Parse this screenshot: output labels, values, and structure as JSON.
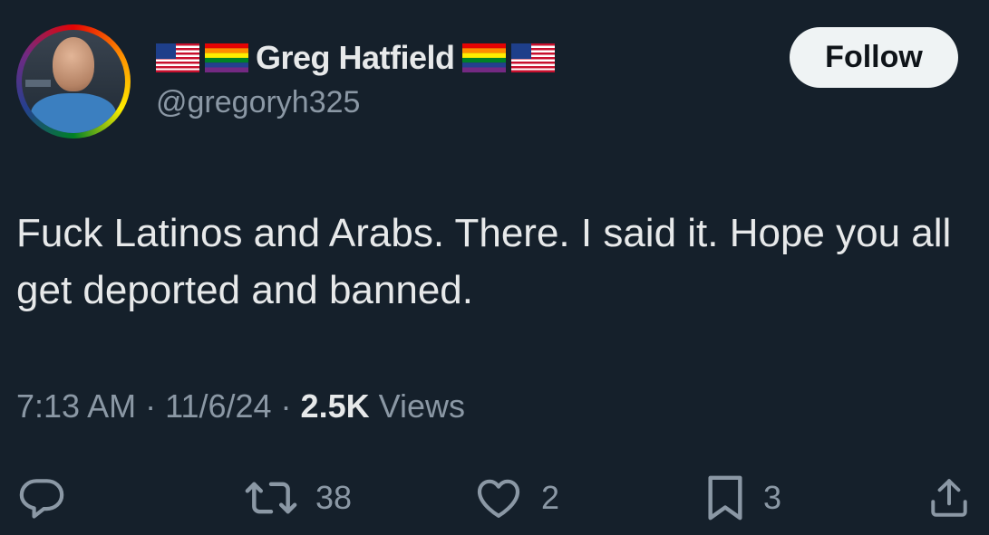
{
  "user": {
    "display_name": "Greg Hatfield",
    "handle": "@gregoryh325",
    "flags": [
      "us-flag-icon",
      "rainbow-flag-icon",
      "rainbow-flag-icon",
      "us-flag-icon"
    ]
  },
  "follow_label": "Follow",
  "tweet": {
    "text": "Fuck Latinos and Arabs. There. I said it. Hope you all get deported and banned."
  },
  "meta": {
    "time": "7:13 AM",
    "sep1": " · ",
    "date": "11/6/24",
    "sep2": " · ",
    "views_count": "2.5K",
    "views_label": " Views"
  },
  "actions": {
    "reply": {
      "icon": "reply-icon",
      "count": ""
    },
    "retweet": {
      "icon": "retweet-icon",
      "count": "38"
    },
    "like": {
      "icon": "heart-icon",
      "count": "2"
    },
    "bookmark": {
      "icon": "bookmark-icon",
      "count": "3"
    },
    "share": {
      "icon": "share-icon",
      "count": ""
    }
  },
  "colors": {
    "background": "#15202b",
    "text_primary": "#e7e9ea",
    "text_secondary": "#8b98a5",
    "follow_bg": "#eff3f4"
  }
}
